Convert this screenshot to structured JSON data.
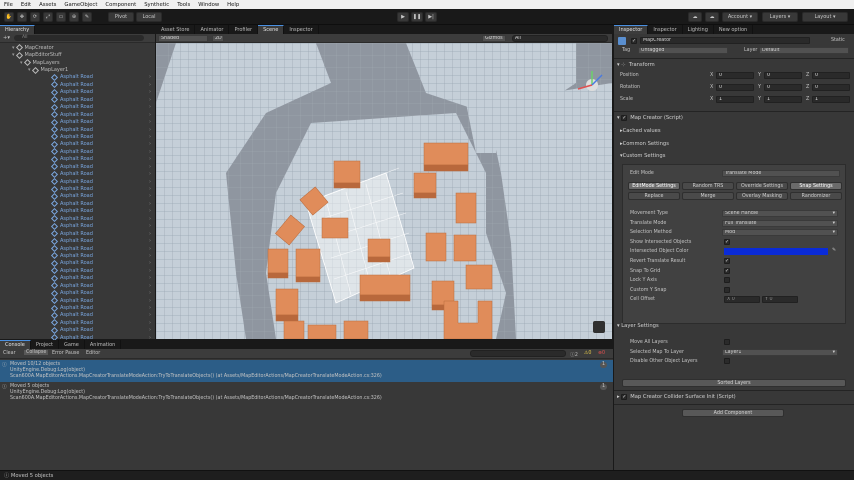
{
  "menu": [
    "File",
    "Edit",
    "Assets",
    "GameObject",
    "Component",
    "Synthetic",
    "Tools",
    "Window",
    "Help"
  ],
  "toolbar": {
    "pivot": "Pivot",
    "local": "Local",
    "account": "Account",
    "layers": "Layers",
    "layout": "Layout"
  },
  "left_tabs": [
    "Hierarchy"
  ],
  "scene_tabs": [
    "Asset Store",
    "Animator",
    "Profiler",
    "Scene",
    "Inspector"
  ],
  "scene_toolbar": {
    "shading": "Shaded",
    "mode": "2D",
    "gizmos": "Gizmos",
    "search": "All"
  },
  "hierarchy": {
    "search": "All",
    "root": [
      {
        "label": "MapCreator",
        "indent": 1
      },
      {
        "label": "MapEditorStuff",
        "indent": 1
      },
      {
        "label": "MapLayers",
        "indent": 2
      },
      {
        "label": "MapLayer1",
        "indent": 3
      }
    ],
    "item_label": "Asphalt Road",
    "item_count": 36
  },
  "console": {
    "tabs": [
      "Console",
      "Project",
      "Game",
      "Animation"
    ],
    "buttons": {
      "clear": "Clear",
      "collapse": "Collapse",
      "error_pause": "Error Pause",
      "editor": "Editor"
    },
    "counts": {
      "info": "2",
      "warning": "0",
      "error": "0"
    },
    "logs": [
      {
        "line1": "Moved 10/12 objects",
        "line2": "UnityEngine.Debug:Log(object)",
        "line3": "Scan600A.MapEditorActions.MapCreatorTranslateModeAction:TryToTranslateObjects() (at Assets/MapEditorActions/MapCreatorTranslateModeAction.cs:326)",
        "selected": true
      },
      {
        "line1": "Moved 5 objects",
        "line2": "UnityEngine.Debug:Log(object)",
        "line3": "Scan600A.MapEditorActions.MapCreatorTranslateModeAction:TryToTranslateObjects() (at Assets/MapEditorActions/MapCreatorTranslateModeAction.cs:326)",
        "selected": false
      }
    ]
  },
  "status_bar": "Moved 5 objects",
  "inspector": {
    "tabs": [
      "Inspector",
      "Inspector",
      "Lighting",
      "New option"
    ],
    "object_name": "MapCreator",
    "static_label": "Static",
    "tag_label": "Tag",
    "tag": "Untagged",
    "layer_label": "Layer",
    "layer": "Default",
    "transform": {
      "title": "Transform",
      "rows": [
        {
          "label": "Position",
          "x": "0",
          "y": "0",
          "z": "0"
        },
        {
          "label": "Rotation",
          "x": "0",
          "y": "0",
          "z": "0"
        },
        {
          "label": "Scale",
          "x": "1",
          "y": "1",
          "z": "1"
        }
      ]
    },
    "script_title": "Map Creator (Script)",
    "foldouts": [
      "Cached values",
      "Common Settings",
      "Custom Settings"
    ],
    "edit_mode_label": "Edit Mode",
    "edit_mode": "Translate Mode",
    "mode_tabs_row1": [
      "EditMode Settings",
      "Random TRS",
      "Override Settings",
      "Snap Settings"
    ],
    "mode_tabs_row2": [
      "Replace",
      "Merge",
      "Overlay Masking",
      "Randomizer"
    ],
    "settings": [
      {
        "label": "Movement Type",
        "value": "Scene Handle",
        "kind": "drop"
      },
      {
        "label": "Translate Mode",
        "value": "Full Translate",
        "kind": "drop"
      },
      {
        "label": "Selection Method",
        "value": "Mod",
        "kind": "drop"
      },
      {
        "label": "Show Intersected Objects",
        "value": "✓",
        "kind": "check"
      },
      {
        "label": "Intersected Object Color",
        "value": "",
        "kind": "color"
      },
      {
        "label": "Revert Translate Result",
        "value": "✓",
        "kind": "check"
      },
      {
        "label": "Snap To Grid",
        "value": "✓",
        "kind": "check"
      },
      {
        "label": "Lock Y Axis",
        "value": "",
        "kind": "check"
      },
      {
        "label": "Custom Y Snap",
        "value": "",
        "kind": "check"
      },
      {
        "label": "Cell Offset",
        "value": "",
        "kind": "xy"
      }
    ],
    "cell_offset": {
      "x": "X 0",
      "y": "Y 0"
    },
    "color_value": "#0a2bd8",
    "layer_settings_title": "Layer Settings",
    "layer_settings": [
      {
        "label": "Move All Layers",
        "value": "",
        "kind": "check"
      },
      {
        "label": "Selected Map To Layer",
        "value": "Layer1",
        "kind": "drop"
      },
      {
        "label": "Disable Other Object Layers",
        "value": "",
        "kind": "check"
      }
    ],
    "sorted_button": "Sorted Layers",
    "collider_title": "Map Creator Collider Surface Init (Script)",
    "add_component": "Add Component"
  },
  "colors": {
    "accent": "#4a90e2",
    "selected_log": "#2c5d87",
    "green": "#2e8b2e",
    "building": "#e08c5a"
  }
}
